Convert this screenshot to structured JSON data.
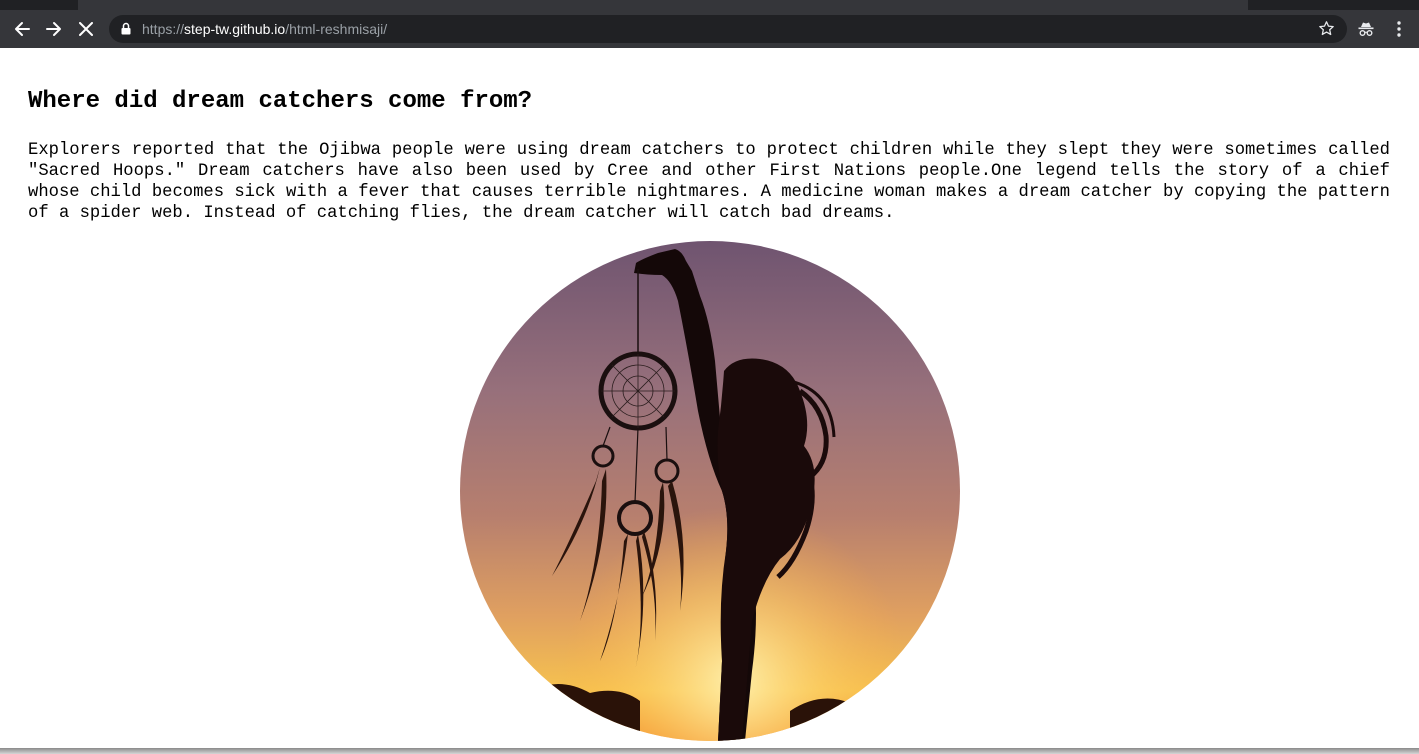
{
  "browser": {
    "url_scheme": "https://",
    "url_host": "step-tw.github.io",
    "url_path": "/html-reshmisaji/",
    "back_icon": "arrow-left-icon",
    "forward_icon": "arrow-right-icon",
    "stop_icon": "close-icon",
    "lock_icon": "lock-icon",
    "bookmark_icon": "star-icon",
    "incognito_icon": "incognito-icon",
    "menu_icon": "more-vert-icon",
    "colors": {
      "frame": "#35363a",
      "omnibox": "#202124",
      "url_host": "#ffffff",
      "url_rest": "#9aa0a6"
    }
  },
  "article": {
    "heading": "Where did dream catchers come from?",
    "body": "Explorers reported that the Ojibwa people were using dream catchers to protect children while they slept they were sometimes called \"Sacred Hoops.\" Dream catchers have also been used by Cree and other First Nations people.One legend tells the story of a chief whose child becomes sick with a fever that causes terrible nightmares. A medicine woman makes a dream catcher by copying the pattern of a spider web. Instead of catching flies, the dream catcher will catch bad dreams.",
    "image_icon": "dreamcatcher-photo"
  }
}
